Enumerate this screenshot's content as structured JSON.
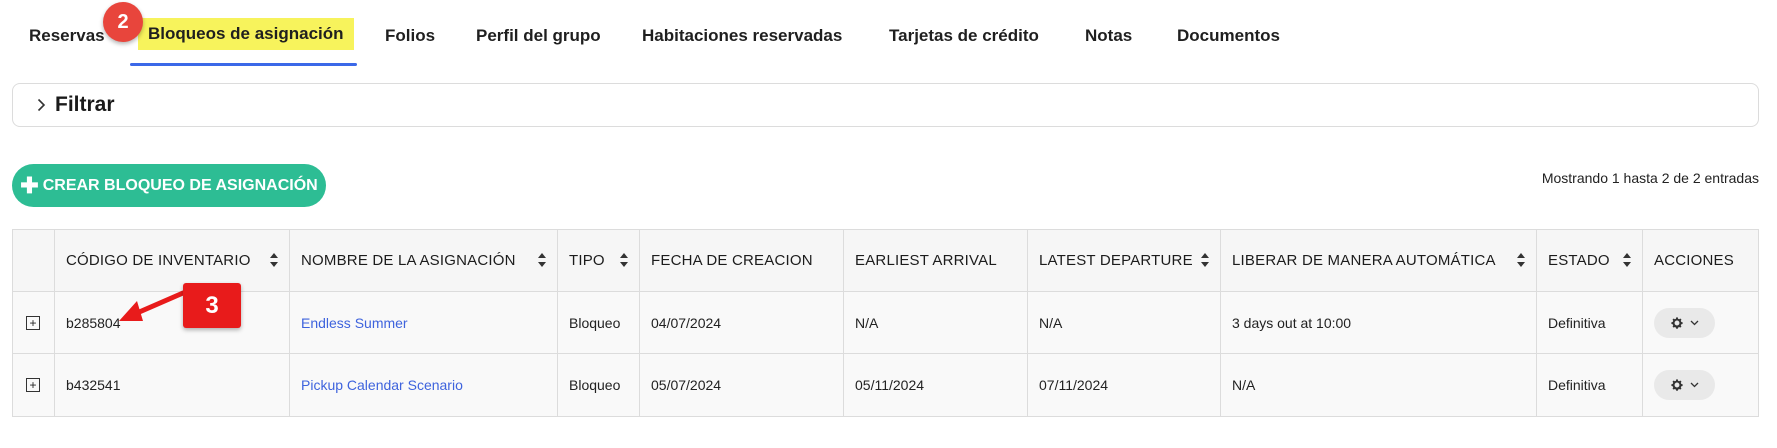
{
  "tabs": [
    {
      "label": "Reservas"
    },
    {
      "label": "Bloqueos de asignación",
      "active": true
    },
    {
      "label": "Folios"
    },
    {
      "label": "Perfil del grupo"
    },
    {
      "label": "Habitaciones reservadas"
    },
    {
      "label": "Tarjetas de crédito"
    },
    {
      "label": "Notas"
    },
    {
      "label": "Documentos"
    }
  ],
  "annotations": {
    "step2": "2",
    "step3": "3"
  },
  "filter": {
    "label": "Filtrar",
    "icon": "chevron-right-icon"
  },
  "create_button": {
    "label": "CREAR BLOQUEO DE ASIGNACIÓN",
    "icon": "plus-icon"
  },
  "showing_text": "Mostrando 1 hasta 2 de 2 entradas",
  "table": {
    "columns": [
      "CÓDIGO DE INVENTARIO",
      "NOMBRE DE LA ASIGNACIÓN",
      "TIPO",
      "FECHA DE CREACION",
      "EARLIEST ARRIVAL",
      "LATEST DEPARTURE",
      "LIBERAR DE MANERA AUTOMÁTICA",
      "ESTADO",
      "ACCIONES"
    ],
    "rows": [
      {
        "code": "b285804",
        "name": "Endless Summer",
        "type": "Bloqueo",
        "created": "04/07/2024",
        "earliest": "N/A",
        "latest": "N/A",
        "release": "3 days out at 10:00",
        "status": "Definitiva"
      },
      {
        "code": "b432541",
        "name": "Pickup Calendar Scenario",
        "type": "Bloqueo",
        "created": "05/07/2024",
        "earliest": "05/11/2024",
        "latest": "07/11/2024",
        "release": "N/A",
        "status": "Definitiva"
      }
    ]
  },
  "colors": {
    "active_tab_highlight": "#f7f35c",
    "tab_underline": "#3b68e8",
    "create_button": "#2dbd94",
    "link": "#3e63dd",
    "annotation_red": "#e81b1b"
  }
}
